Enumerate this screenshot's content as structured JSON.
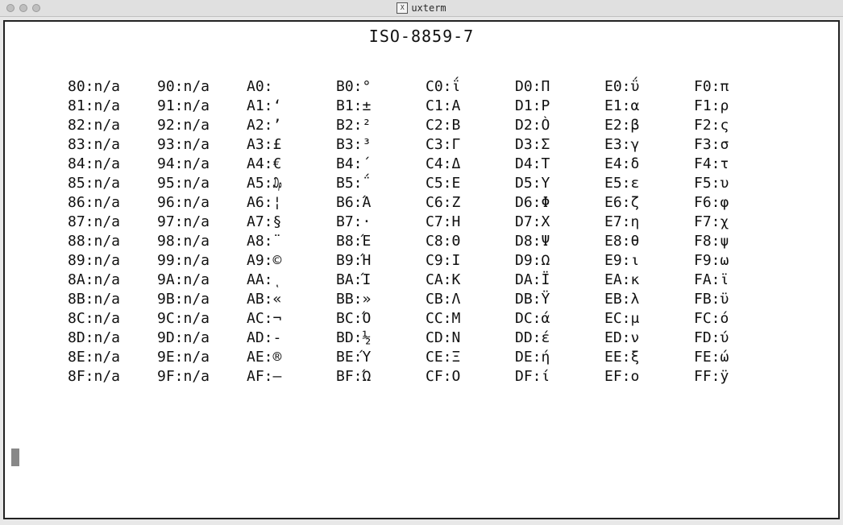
{
  "window": {
    "app_icon_label": "X",
    "title": "uxterm"
  },
  "encoding_title": "ISO-8859-7",
  "columns": [
    [
      {
        "code": "80",
        "glyph": "n/a"
      },
      {
        "code": "81",
        "glyph": "n/a"
      },
      {
        "code": "82",
        "glyph": "n/a"
      },
      {
        "code": "83",
        "glyph": "n/a"
      },
      {
        "code": "84",
        "glyph": "n/a"
      },
      {
        "code": "85",
        "glyph": "n/a"
      },
      {
        "code": "86",
        "glyph": "n/a"
      },
      {
        "code": "87",
        "glyph": "n/a"
      },
      {
        "code": "88",
        "glyph": "n/a"
      },
      {
        "code": "89",
        "glyph": "n/a"
      },
      {
        "code": "8A",
        "glyph": "n/a"
      },
      {
        "code": "8B",
        "glyph": "n/a"
      },
      {
        "code": "8C",
        "glyph": "n/a"
      },
      {
        "code": "8D",
        "glyph": "n/a"
      },
      {
        "code": "8E",
        "glyph": "n/a"
      },
      {
        "code": "8F",
        "glyph": "n/a"
      }
    ],
    [
      {
        "code": "90",
        "glyph": "n/a"
      },
      {
        "code": "91",
        "glyph": "n/a"
      },
      {
        "code": "92",
        "glyph": "n/a"
      },
      {
        "code": "93",
        "glyph": "n/a"
      },
      {
        "code": "94",
        "glyph": "n/a"
      },
      {
        "code": "95",
        "glyph": "n/a"
      },
      {
        "code": "96",
        "glyph": "n/a"
      },
      {
        "code": "97",
        "glyph": "n/a"
      },
      {
        "code": "98",
        "glyph": "n/a"
      },
      {
        "code": "99",
        "glyph": "n/a"
      },
      {
        "code": "9A",
        "glyph": "n/a"
      },
      {
        "code": "9B",
        "glyph": "n/a"
      },
      {
        "code": "9C",
        "glyph": "n/a"
      },
      {
        "code": "9D",
        "glyph": "n/a"
      },
      {
        "code": "9E",
        "glyph": "n/a"
      },
      {
        "code": "9F",
        "glyph": "n/a"
      }
    ],
    [
      {
        "code": "A0",
        "glyph": " "
      },
      {
        "code": "A1",
        "glyph": "‘"
      },
      {
        "code": "A2",
        "glyph": "’"
      },
      {
        "code": "A3",
        "glyph": "£"
      },
      {
        "code": "A4",
        "glyph": "€"
      },
      {
        "code": "A5",
        "glyph": "₯"
      },
      {
        "code": "A6",
        "glyph": "¦"
      },
      {
        "code": "A7",
        "glyph": "§"
      },
      {
        "code": "A8",
        "glyph": "¨"
      },
      {
        "code": "A9",
        "glyph": "©"
      },
      {
        "code": "AA",
        "glyph": "ͺ"
      },
      {
        "code": "AB",
        "glyph": "«"
      },
      {
        "code": "AC",
        "glyph": "¬"
      },
      {
        "code": "AD",
        "glyph": "-"
      },
      {
        "code": "AE",
        "glyph": "®"
      },
      {
        "code": "AF",
        "glyph": "―"
      }
    ],
    [
      {
        "code": "B0",
        "glyph": "°"
      },
      {
        "code": "B1",
        "glyph": "±"
      },
      {
        "code": "B2",
        "glyph": "²"
      },
      {
        "code": "B3",
        "glyph": "³"
      },
      {
        "code": "B4",
        "glyph": "΄"
      },
      {
        "code": "B5",
        "glyph": "΅"
      },
      {
        "code": "B6",
        "glyph": "Ά"
      },
      {
        "code": "B7",
        "glyph": "·"
      },
      {
        "code": "B8",
        "glyph": "Έ"
      },
      {
        "code": "B9",
        "glyph": "Ή"
      },
      {
        "code": "BA",
        "glyph": "Ί"
      },
      {
        "code": "BB",
        "glyph": "»"
      },
      {
        "code": "BC",
        "glyph": "Ό"
      },
      {
        "code": "BD",
        "glyph": "½"
      },
      {
        "code": "BE",
        "glyph": "Ύ"
      },
      {
        "code": "BF",
        "glyph": "Ώ"
      }
    ],
    [
      {
        "code": "C0",
        "glyph": "ΐ"
      },
      {
        "code": "C1",
        "glyph": "Α"
      },
      {
        "code": "C2",
        "glyph": "Β"
      },
      {
        "code": "C3",
        "glyph": "Γ"
      },
      {
        "code": "C4",
        "glyph": "Δ"
      },
      {
        "code": "C5",
        "glyph": "Ε"
      },
      {
        "code": "C6",
        "glyph": "Ζ"
      },
      {
        "code": "C7",
        "glyph": "Η"
      },
      {
        "code": "C8",
        "glyph": "Θ"
      },
      {
        "code": "C9",
        "glyph": "Ι"
      },
      {
        "code": "CA",
        "glyph": "Κ"
      },
      {
        "code": "CB",
        "glyph": "Λ"
      },
      {
        "code": "CC",
        "glyph": "Μ"
      },
      {
        "code": "CD",
        "glyph": "Ν"
      },
      {
        "code": "CE",
        "glyph": "Ξ"
      },
      {
        "code": "CF",
        "glyph": "Ο"
      }
    ],
    [
      {
        "code": "D0",
        "glyph": "Π"
      },
      {
        "code": "D1",
        "glyph": "Ρ"
      },
      {
        "code": "D2",
        "glyph": "Ò"
      },
      {
        "code": "D3",
        "glyph": "Σ"
      },
      {
        "code": "D4",
        "glyph": "Τ"
      },
      {
        "code": "D5",
        "glyph": "Υ"
      },
      {
        "code": "D6",
        "glyph": "Φ"
      },
      {
        "code": "D7",
        "glyph": "Χ"
      },
      {
        "code": "D8",
        "glyph": "Ψ"
      },
      {
        "code": "D9",
        "glyph": "Ω"
      },
      {
        "code": "DA",
        "glyph": "Ϊ"
      },
      {
        "code": "DB",
        "glyph": "Ϋ"
      },
      {
        "code": "DC",
        "glyph": "ά"
      },
      {
        "code": "DD",
        "glyph": "έ"
      },
      {
        "code": "DE",
        "glyph": "ή"
      },
      {
        "code": "DF",
        "glyph": "ί"
      }
    ],
    [
      {
        "code": "E0",
        "glyph": "ΰ"
      },
      {
        "code": "E1",
        "glyph": "α"
      },
      {
        "code": "E2",
        "glyph": "β"
      },
      {
        "code": "E3",
        "glyph": "γ"
      },
      {
        "code": "E4",
        "glyph": "δ"
      },
      {
        "code": "E5",
        "glyph": "ε"
      },
      {
        "code": "E6",
        "glyph": "ζ"
      },
      {
        "code": "E7",
        "glyph": "η"
      },
      {
        "code": "E8",
        "glyph": "θ"
      },
      {
        "code": "E9",
        "glyph": "ι"
      },
      {
        "code": "EA",
        "glyph": "κ"
      },
      {
        "code": "EB",
        "glyph": "λ"
      },
      {
        "code": "EC",
        "glyph": "μ"
      },
      {
        "code": "ED",
        "glyph": "ν"
      },
      {
        "code": "EE",
        "glyph": "ξ"
      },
      {
        "code": "EF",
        "glyph": "ο"
      }
    ],
    [
      {
        "code": "F0",
        "glyph": "π"
      },
      {
        "code": "F1",
        "glyph": "ρ"
      },
      {
        "code": "F2",
        "glyph": "ς"
      },
      {
        "code": "F3",
        "glyph": "σ"
      },
      {
        "code": "F4",
        "glyph": "τ"
      },
      {
        "code": "F5",
        "glyph": "υ"
      },
      {
        "code": "F6",
        "glyph": "φ"
      },
      {
        "code": "F7",
        "glyph": "χ"
      },
      {
        "code": "F8",
        "glyph": "ψ"
      },
      {
        "code": "F9",
        "glyph": "ω"
      },
      {
        "code": "FA",
        "glyph": "ϊ"
      },
      {
        "code": "FB",
        "glyph": "ϋ"
      },
      {
        "code": "FC",
        "glyph": "ό"
      },
      {
        "code": "FD",
        "glyph": "ύ"
      },
      {
        "code": "FE",
        "glyph": "ώ"
      },
      {
        "code": "FF",
        "glyph": "ÿ"
      }
    ]
  ]
}
